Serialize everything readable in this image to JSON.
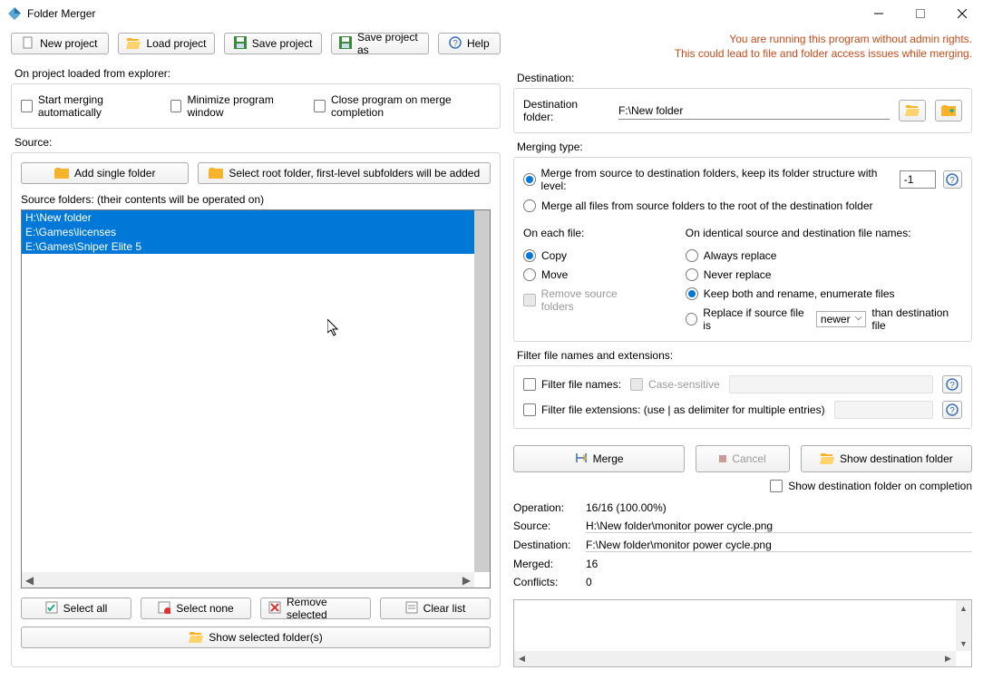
{
  "window": {
    "title": "Folder Merger"
  },
  "toolbar": {
    "new_project": "New project",
    "load_project": "Load project",
    "save_project": "Save project",
    "save_project_as": "Save project as",
    "help": "Help"
  },
  "warning": {
    "line1": "You are running this program without admin rights.",
    "line2": "This could lead to file and folder access issues while merging."
  },
  "explorer": {
    "group_label": "On project loaded from explorer:",
    "start_merge": "Start merging automatically",
    "minimize": "Minimize program window",
    "close_on_complete": "Close program on merge completion"
  },
  "source": {
    "group_label": "Source:",
    "add_single": "Add single folder",
    "select_root": "Select root folder, first-level subfolders will be added",
    "list_label": "Source folders: (their contents will be operated on)",
    "items": [
      "H:\\New folder",
      "E:\\Games\\licenses",
      "E:\\Games\\Sniper Elite 5"
    ],
    "select_all": "Select all",
    "select_none": "Select none",
    "remove_selected": "Remove selected",
    "clear_list": "Clear list",
    "show_selected": "Show selected folder(s)"
  },
  "destination": {
    "group_label": "Destination:",
    "label": "Destination folder:",
    "value": "F:\\New folder"
  },
  "merging_type": {
    "group_label": "Merging type:",
    "opt_structure": "Merge from source to destination folders, keep its folder structure with level:",
    "level": "-1",
    "opt_flat": "Merge all files from source folders to the root of the destination folder"
  },
  "on_each_file": {
    "label": "On each file:",
    "copy": "Copy",
    "move": "Move",
    "remove_src": "Remove source folders"
  },
  "on_identical": {
    "label": "On identical source and destination file names:",
    "always_replace": "Always replace",
    "never_replace": "Never replace",
    "keep_both": "Keep both and rename, enumerate files",
    "replace_if": "Replace if source file is",
    "newer": "newer",
    "than": "than destination file"
  },
  "filter": {
    "group_label": "Filter file names and extensions:",
    "names": "Filter file names:",
    "case_sensitive": "Case-sensitive",
    "extensions": "Filter file extensions: (use | as delimiter for multiple entries)"
  },
  "action": {
    "merge": "Merge",
    "cancel": "Cancel",
    "show_dest": "Show destination folder",
    "show_on_complete": "Show destination folder on completion"
  },
  "progress": {
    "operation_label": "Operation:",
    "operation": "16/16 (100.00%)",
    "source_label": "Source:",
    "source": "H:\\New folder\\monitor power cycle.png",
    "destination_label": "Destination:",
    "destination": "F:\\New folder\\monitor power cycle.png",
    "merged_label": "Merged:",
    "merged": "16",
    "conflicts_label": "Conflicts:",
    "conflicts": "0"
  },
  "icons": {
    "folder_color": "#f7b32b",
    "help_color": "#3b6fb6"
  }
}
